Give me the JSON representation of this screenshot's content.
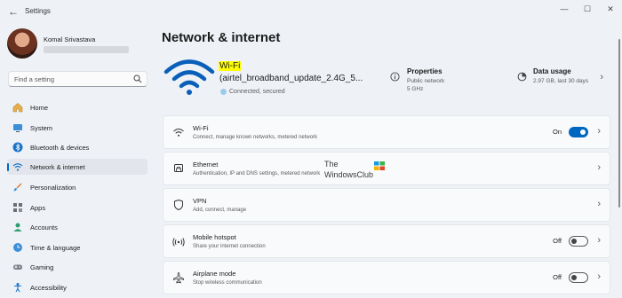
{
  "app": {
    "title": "Settings"
  },
  "window": {
    "back": "←",
    "minimize": "—",
    "maximize": "☐",
    "close": "✕"
  },
  "user": {
    "name": "Komal Srivastava"
  },
  "search": {
    "placeholder": "Find a setting"
  },
  "sidebar": {
    "items": [
      {
        "label": "Home",
        "icon": "home-icon",
        "active": false
      },
      {
        "label": "System",
        "icon": "monitor-icon",
        "active": false
      },
      {
        "label": "Bluetooth & devices",
        "icon": "bluetooth-icon",
        "active": false
      },
      {
        "label": "Network & internet",
        "icon": "wifi-icon",
        "active": true
      },
      {
        "label": "Personalization",
        "icon": "brush-icon",
        "active": false
      },
      {
        "label": "Apps",
        "icon": "apps-icon",
        "active": false
      },
      {
        "label": "Accounts",
        "icon": "person-icon",
        "active": false
      },
      {
        "label": "Time & language",
        "icon": "globe-clock-icon",
        "active": false
      },
      {
        "label": "Gaming",
        "icon": "gamepad-icon",
        "active": false
      },
      {
        "label": "Accessibility",
        "icon": "accessibility-icon",
        "active": false
      }
    ]
  },
  "page": {
    "title": "Network & internet"
  },
  "hero": {
    "name": "Wi-Fi",
    "ssid": "(airtel_broadband_update_2.4G_5...",
    "status": "Connected, secured",
    "properties": {
      "title": "Properties",
      "line1": "Public network",
      "line2": "5 GHz"
    },
    "data_usage": {
      "title": "Data usage",
      "line1": "2.97 GB, last 30 days"
    }
  },
  "cards": [
    {
      "title": "Wi-Fi",
      "sub": "Connect, manage known networks, metered network",
      "state": "On",
      "toggle": "on",
      "icon": "wifi-icon"
    },
    {
      "title": "Ethernet",
      "sub": "Authentication, IP and DNS settings, metered network",
      "state": "",
      "toggle": "",
      "icon": "ethernet-icon"
    },
    {
      "title": "VPN",
      "sub": "Add, connect, manage",
      "state": "",
      "toggle": "",
      "icon": "shield-icon"
    },
    {
      "title": "Mobile hotspot",
      "sub": "Share your internet connection",
      "state": "Off",
      "toggle": "off",
      "icon": "hotspot-icon"
    },
    {
      "title": "Airplane mode",
      "sub": "Stop wireless communication",
      "state": "Off",
      "toggle": "off",
      "icon": "airplane-icon"
    }
  ],
  "watermark": {
    "line1": "The",
    "line2": "WindowsClub"
  },
  "colors": {
    "accent": "#0067c0",
    "highlight": "#ffff00",
    "background": "#eef2f7"
  }
}
